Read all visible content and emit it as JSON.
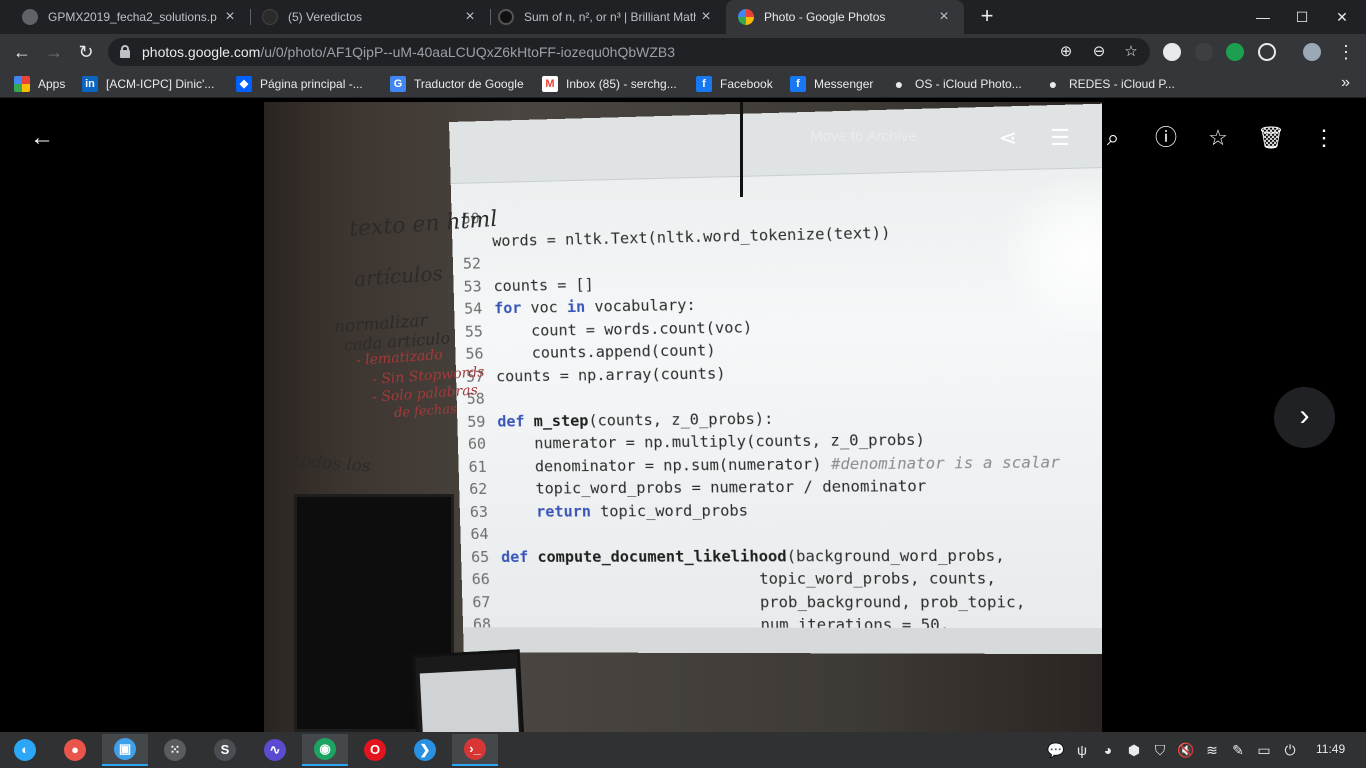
{
  "browser": {
    "tabs": [
      {
        "title": "GPMX2019_fecha2_solutions.p",
        "active": false
      },
      {
        "title": "(5) Veredictos",
        "active": false
      },
      {
        "title": "Sum of n, n², or n³ | Brilliant Math",
        "active": false
      },
      {
        "title": "Photo - Google Photos",
        "active": true
      }
    ],
    "new_tab_label": "+",
    "window_controls": {
      "minimize": "—",
      "maximize": "☐",
      "close": "✕"
    },
    "url_host": "photos.google.com",
    "url_path": "/u/0/photo/AF1QipP--uM-40aaLCUQxZ6kHtoFF-iozequ0hQbWZB3",
    "bookmarks": [
      {
        "label": "Apps",
        "icon": "apps-grid-icon"
      },
      {
        "label": "[ACM-ICPC] Dinic'...",
        "icon": "linkedin-icon"
      },
      {
        "label": "Página principal -...",
        "icon": "dropbox-icon"
      },
      {
        "label": "Traductor de Google",
        "icon": "google-translate-icon"
      },
      {
        "label": "Inbox (85) - serchg...",
        "icon": "gmail-icon"
      },
      {
        "label": "Facebook",
        "icon": "facebook-icon"
      },
      {
        "label": "Messenger",
        "icon": "facebook-icon"
      },
      {
        "label": "OS - iCloud Photo...",
        "icon": "apple-icon"
      },
      {
        "label": "REDES - iCloud P...",
        "icon": "apple-icon"
      }
    ],
    "bookmarks_overflow": "»"
  },
  "viewer": {
    "archive_label": "Move to Archive",
    "toolbar_icons": [
      "share-icon",
      "edit-adjust-icon",
      "zoom-in-icon",
      "info-icon",
      "favorite-star-icon",
      "delete-trash-icon",
      "more-vert-icon"
    ]
  },
  "photo": {
    "code_lines": [
      {
        "n": "50",
        "segments": [
          {
            "t": "",
            "c": ""
          }
        ]
      },
      {
        "n": "",
        "segments": [
          {
            "t": "words = nltk.Text(nltk.word_tokenize(text))",
            "c": ""
          }
        ]
      },
      {
        "n": "52",
        "segments": [
          {
            "t": "",
            "c": ""
          }
        ]
      },
      {
        "n": "53",
        "segments": [
          {
            "t": "counts = []",
            "c": ""
          }
        ]
      },
      {
        "n": "54",
        "segments": [
          {
            "t": "for",
            "c": "kw"
          },
          {
            "t": " voc ",
            "c": ""
          },
          {
            "t": "in",
            "c": "kw"
          },
          {
            "t": " vocabulary:",
            "c": ""
          }
        ]
      },
      {
        "n": "55",
        "segments": [
          {
            "t": "    count = words.count(voc)",
            "c": ""
          }
        ]
      },
      {
        "n": "56",
        "segments": [
          {
            "t": "    counts.append(count)",
            "c": ""
          }
        ]
      },
      {
        "n": "57",
        "segments": [
          {
            "t": "counts = np.array(counts)",
            "c": ""
          }
        ]
      },
      {
        "n": "58",
        "segments": [
          {
            "t": "",
            "c": ""
          }
        ]
      },
      {
        "n": "59",
        "segments": [
          {
            "t": "def",
            "c": "kw"
          },
          {
            "t": " ",
            "c": ""
          },
          {
            "t": "m_step",
            "c": "fn"
          },
          {
            "t": "(counts, z_0_probs):",
            "c": ""
          }
        ]
      },
      {
        "n": "60",
        "segments": [
          {
            "t": "    numerator = np.multiply(counts, z_0_probs)",
            "c": ""
          }
        ]
      },
      {
        "n": "61",
        "segments": [
          {
            "t": "    denominator = np.sum(numerator) ",
            "c": ""
          },
          {
            "t": "#denominator is a scalar",
            "c": "cm"
          }
        ]
      },
      {
        "n": "62",
        "segments": [
          {
            "t": "    topic_word_probs = numerator / denominator",
            "c": ""
          }
        ]
      },
      {
        "n": "63",
        "segments": [
          {
            "t": "    ",
            "c": ""
          },
          {
            "t": "return",
            "c": "kw"
          },
          {
            "t": " topic_word_probs",
            "c": ""
          }
        ]
      },
      {
        "n": "64",
        "segments": [
          {
            "t": "",
            "c": ""
          }
        ]
      },
      {
        "n": "65",
        "segments": [
          {
            "t": "def",
            "c": "kw"
          },
          {
            "t": " ",
            "c": ""
          },
          {
            "t": "compute_document_likelihood",
            "c": "fn"
          },
          {
            "t": "(background_word_probs,",
            "c": ""
          }
        ]
      },
      {
        "n": "66",
        "segments": [
          {
            "t": "                            topic_word_probs, counts,",
            "c": ""
          }
        ]
      },
      {
        "n": "67",
        "segments": [
          {
            "t": "                            prob_background, prob_topic,",
            "c": ""
          }
        ]
      },
      {
        "n": "68",
        "segments": [
          {
            "t": "                            num_iterations = 50,",
            "c": ""
          }
        ]
      }
    ],
    "handwriting": [
      {
        "text": "texto en html",
        "color": "dark"
      },
      {
        "text": "artículos",
        "color": "dark"
      },
      {
        "text": "normalizar",
        "color": "dark"
      },
      {
        "text": "cada artículo",
        "color": "dark"
      },
      {
        "text": "- lematizado",
        "color": "red"
      },
      {
        "text": "- Sin Stopwords",
        "color": "red"
      },
      {
        "text": "- Solo palabras",
        "color": "red"
      },
      {
        "text": "de fechas",
        "color": "red"
      },
      {
        "text": "todos los",
        "color": "dark"
      }
    ]
  },
  "taskbar": {
    "apps": [
      {
        "name": "launcher",
        "glyph": "◐",
        "color": "#2ca7f8",
        "on": false
      },
      {
        "name": "screen-recorder",
        "glyph": "●",
        "color": "#e9544b",
        "on": false
      },
      {
        "name": "app-store",
        "glyph": "▣",
        "color": "#3ea0e8",
        "on": true
      },
      {
        "name": "multitask-view",
        "glyph": "⁙",
        "color": "#5a5d60",
        "on": false
      },
      {
        "name": "sublime-text",
        "glyph": "S",
        "color": "#4a4d52",
        "on": false
      },
      {
        "name": "system-monitor",
        "glyph": "∿",
        "color": "#5b4bd1",
        "on": false
      },
      {
        "name": "chrome",
        "glyph": "◉",
        "color": "#1da462",
        "on": true
      },
      {
        "name": "opera",
        "glyph": "O",
        "color": "#e3141e",
        "on": false
      },
      {
        "name": "vscode",
        "glyph": "❯",
        "color": "#2a91e0",
        "on": false
      },
      {
        "name": "terminal",
        "glyph": "›_",
        "color": "#d83535",
        "on": true
      }
    ],
    "tray_icons": [
      "chat-icon",
      "usb-icon",
      "game-icon",
      "color-picker-icon",
      "shield-icon",
      "volume-muted-icon",
      "wifi-icon",
      "dropper-icon",
      "battery-icon",
      "power-icon"
    ],
    "clock": "11:49"
  }
}
